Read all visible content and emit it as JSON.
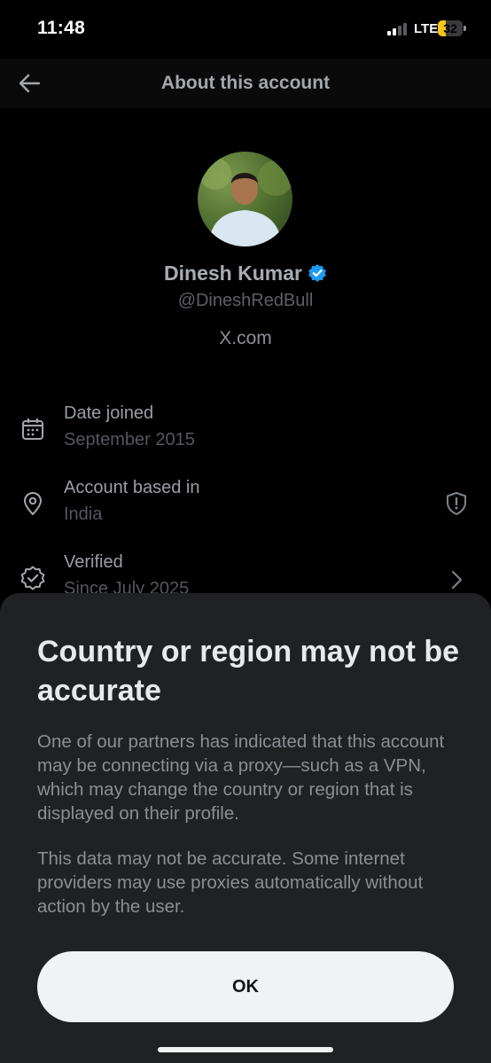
{
  "status_bar": {
    "time": "11:48",
    "network": "LTE",
    "battery": "32",
    "battery_level": 0.32
  },
  "nav": {
    "title": "About this account",
    "back_icon": "arrow-left-icon"
  },
  "profile": {
    "name": "Dinesh Kumar",
    "handle": "@DineshRedBull",
    "domain": "X.com",
    "verified_icon": "verified-badge-icon",
    "accent": "#1d9bf0"
  },
  "details": [
    {
      "label": "Date joined",
      "value": "September 2015",
      "icon": "calendar-icon"
    },
    {
      "label": "Account based in",
      "value": "India",
      "icon": "location-pin-icon",
      "right_icon": "shield-alert-icon"
    },
    {
      "label": "Verified",
      "value": "Since July 2025",
      "icon": "verified-check-icon",
      "right_icon": "chevron-right-icon"
    }
  ],
  "sheet": {
    "title": "Country or region may not be accurate",
    "paragraphs": [
      "One of our partners has indicated that this account may be connecting via a proxy—such as a VPN, which may change the country or region that is displayed on their profile.",
      "This data may not be accurate. Some internet providers may use proxies automatically without action by the user."
    ],
    "ok_label": "OK"
  }
}
